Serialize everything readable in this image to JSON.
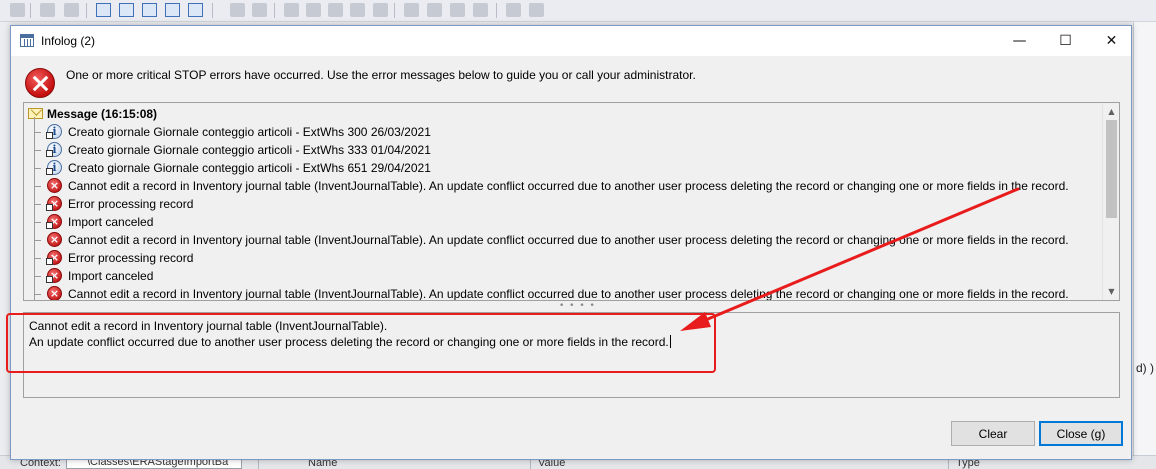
{
  "dialog": {
    "title": "Infolog (2)",
    "header_message": "One or more critical STOP errors have occurred. Use the error messages below to guide you or call your administrator.",
    "controls": {
      "minimize": "—",
      "maximize": "☐",
      "close": "✕"
    }
  },
  "tree": {
    "header": "Message (16:15:08)",
    "items": [
      {
        "type": "info",
        "text": "Creato giornale Giornale conteggio articoli - ExtWhs 300 26/03/2021"
      },
      {
        "type": "info",
        "text": "Creato giornale Giornale conteggio articoli - ExtWhs 333 01/04/2021"
      },
      {
        "type": "info",
        "text": "Creato giornale Giornale conteggio articoli - ExtWhs 651 29/04/2021"
      },
      {
        "type": "error",
        "text": "Cannot edit a record in Inventory journal table (InventJournalTable). An update conflict occurred due to another user process deleting the record or changing one or more fields in the record."
      },
      {
        "type": "error-doc",
        "text": "Error processing record"
      },
      {
        "type": "error-doc",
        "text": "Import canceled"
      },
      {
        "type": "error",
        "text": "Cannot edit a record in Inventory journal table (InventJournalTable). An update conflict occurred due to another user process deleting the record or changing one or more fields in the record."
      },
      {
        "type": "error-doc",
        "text": "Error processing record"
      },
      {
        "type": "error-doc",
        "text": "Import canceled"
      },
      {
        "type": "error",
        "text": "Cannot edit a record in Inventory journal table (InventJournalTable). An update conflict occurred due to another user process deleting the record or changing one or more fields in the record."
      }
    ]
  },
  "detail": {
    "line1": "Cannot edit a record in Inventory journal table (InventJournalTable).",
    "line2": "An update conflict occurred due to another user process deleting the record or changing one or more fields in the record."
  },
  "buttons": {
    "clear": "Clear",
    "close": "Close (g)"
  },
  "background": {
    "right_fragment": "d) )",
    "bottom_context_label": "Context:",
    "bottom_path": "\\Classes\\ERAStageImportBa",
    "col_name": "Name",
    "col_value": "Value",
    "col_type": "Type"
  },
  "colors": {
    "annotation": "#e81c1c",
    "error_red": "#c41a1a",
    "default_button_border": "#0078d7"
  }
}
